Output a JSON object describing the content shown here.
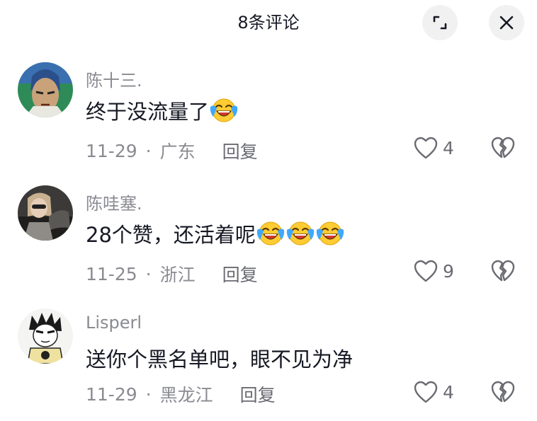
{
  "header": {
    "title": "8条评论",
    "expand_icon": "expand-icon",
    "close_icon": "close-icon"
  },
  "colors": {
    "text_primary": "#161823",
    "text_secondary": "#8a8b91",
    "button_bg": "#f1f1f2"
  },
  "comments": [
    {
      "username": "陈十三.",
      "text": "终于没流量了",
      "emoji_count": 1,
      "emoji": "tears-of-joy-emoji",
      "date": "11-29",
      "separator": "·",
      "location": "广东",
      "reply_label": "回复",
      "likes": "4"
    },
    {
      "username": "陈哇塞.",
      "text": "28个赞，还活着呢",
      "emoji_count": 3,
      "emoji": "tears-of-joy-emoji",
      "date": "11-25",
      "separator": "·",
      "location": "浙江",
      "reply_label": "回复",
      "likes": "9"
    },
    {
      "username": "Lisperl",
      "text": "送你个黑名单吧，眼不见为净",
      "emoji_count": 0,
      "date": "11-29",
      "separator": "·",
      "location": "黑龙江",
      "reply_label": "回复",
      "likes": "4"
    }
  ]
}
